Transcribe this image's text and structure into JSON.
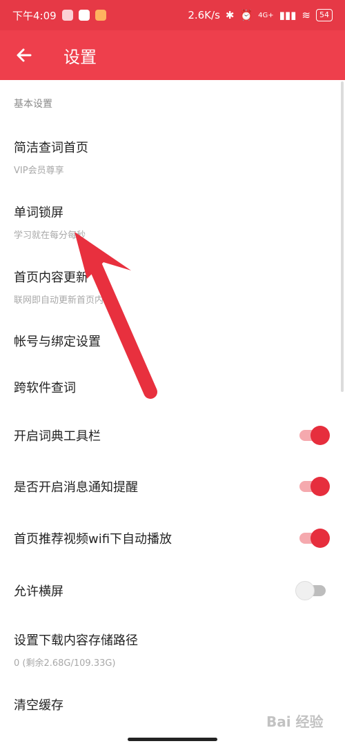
{
  "status": {
    "time": "下午4:09",
    "netspeed": "2.6K/s",
    "battery": "54",
    "network": "4G+"
  },
  "appbar": {
    "back_icon": "←",
    "title": "设置"
  },
  "section_label": "基本设置",
  "rows": [
    {
      "label": "简洁查词首页",
      "sub": "VIP会员尊享"
    },
    {
      "label": "单词锁屏",
      "sub": "学习就在每分每秒"
    },
    {
      "label": "首页内容更新",
      "sub": "联网即自动更新首页内容"
    },
    {
      "label": "帐号与绑定设置"
    },
    {
      "label": "跨软件查词"
    },
    {
      "label": "开启词典工具栏",
      "toggle": true
    },
    {
      "label": "是否开启消息通知提醒",
      "toggle": true
    },
    {
      "label": "首页推荐视频wifi下自动播放",
      "toggle": true
    },
    {
      "label": "允许横屏",
      "toggle": false
    },
    {
      "label": "设置下载内容存储路径",
      "sub": "0 (剩余2.68G/109.33G)"
    },
    {
      "label": "清空缓存"
    }
  ],
  "watermark": "Bai 经验",
  "colors": {
    "accent": "#ee3f4c",
    "toggle_on": "#e62e3d"
  }
}
